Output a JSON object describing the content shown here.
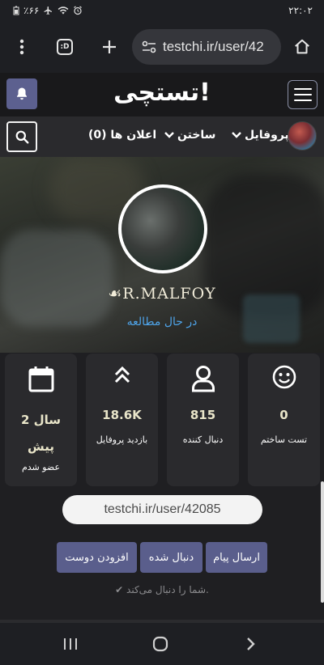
{
  "status_bar": {
    "battery": "٪۶۶",
    "time": "۲۲:۰۲"
  },
  "browser": {
    "url": "testchi.ir/user/42",
    "tab_count": ":D"
  },
  "header": {
    "logo": "تستچی!"
  },
  "nav": {
    "profile": "پروفایل",
    "build": "ساختن",
    "notifications": "اعلان ها (0)"
  },
  "profile": {
    "username": "☙R.MALFOY",
    "status": "در حال مطالعه"
  },
  "stats": [
    {
      "icon": "smile-icon",
      "value": "0",
      "label": "تست ساختم"
    },
    {
      "icon": "user-icon",
      "value": "815",
      "label": "دنبال کننده"
    },
    {
      "icon": "chevrons-up-icon",
      "value": "18.6K",
      "label": "بازدید پروفایل"
    },
    {
      "icon": "calendar-icon",
      "value": "2 سال پیش",
      "label": "عضو شدم"
    }
  ],
  "share_url": "testchi.ir/user/42085",
  "actions": {
    "message": "ارسال پیام",
    "followed": "دنبال شده",
    "add_friend": "افزودن دوست"
  },
  "follow_note": "✔ شما را دنبال می‌کند.",
  "colors": {
    "accent": "#5a5e8c",
    "link": "#4ea3e8",
    "value": "#e9e5c9"
  }
}
